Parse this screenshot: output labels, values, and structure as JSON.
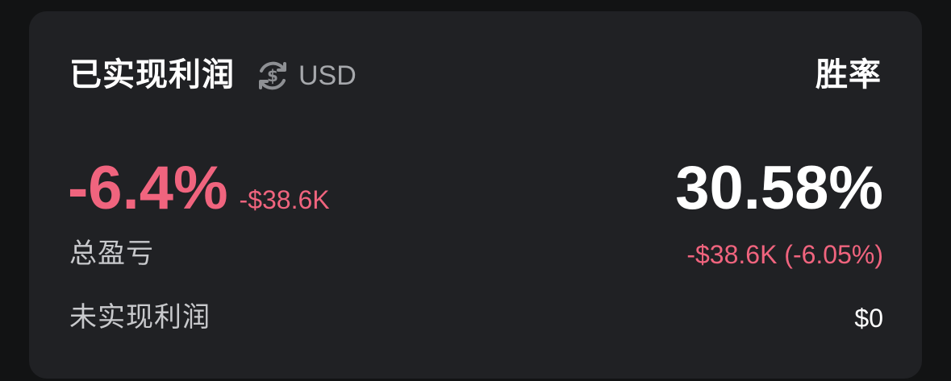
{
  "card": {
    "title": "已实现利润",
    "currency_icon": "dollar-refresh-icon",
    "currency": "USD",
    "winrate_label": "胜率",
    "realized_pnl_percent": "-6.4%",
    "realized_pnl_amount": "-$38.6K",
    "winrate_value": "30.58%",
    "rows": [
      {
        "label": "总盈亏",
        "value": "-$38.6K (-6.05%)"
      },
      {
        "label": "未实现利润",
        "value": "$0"
      }
    ]
  },
  "colors": {
    "background": "#121314",
    "card": "#202124",
    "negative": "#f0647e",
    "primary_text": "#ffffff",
    "secondary_text": "#a6a8ac"
  }
}
